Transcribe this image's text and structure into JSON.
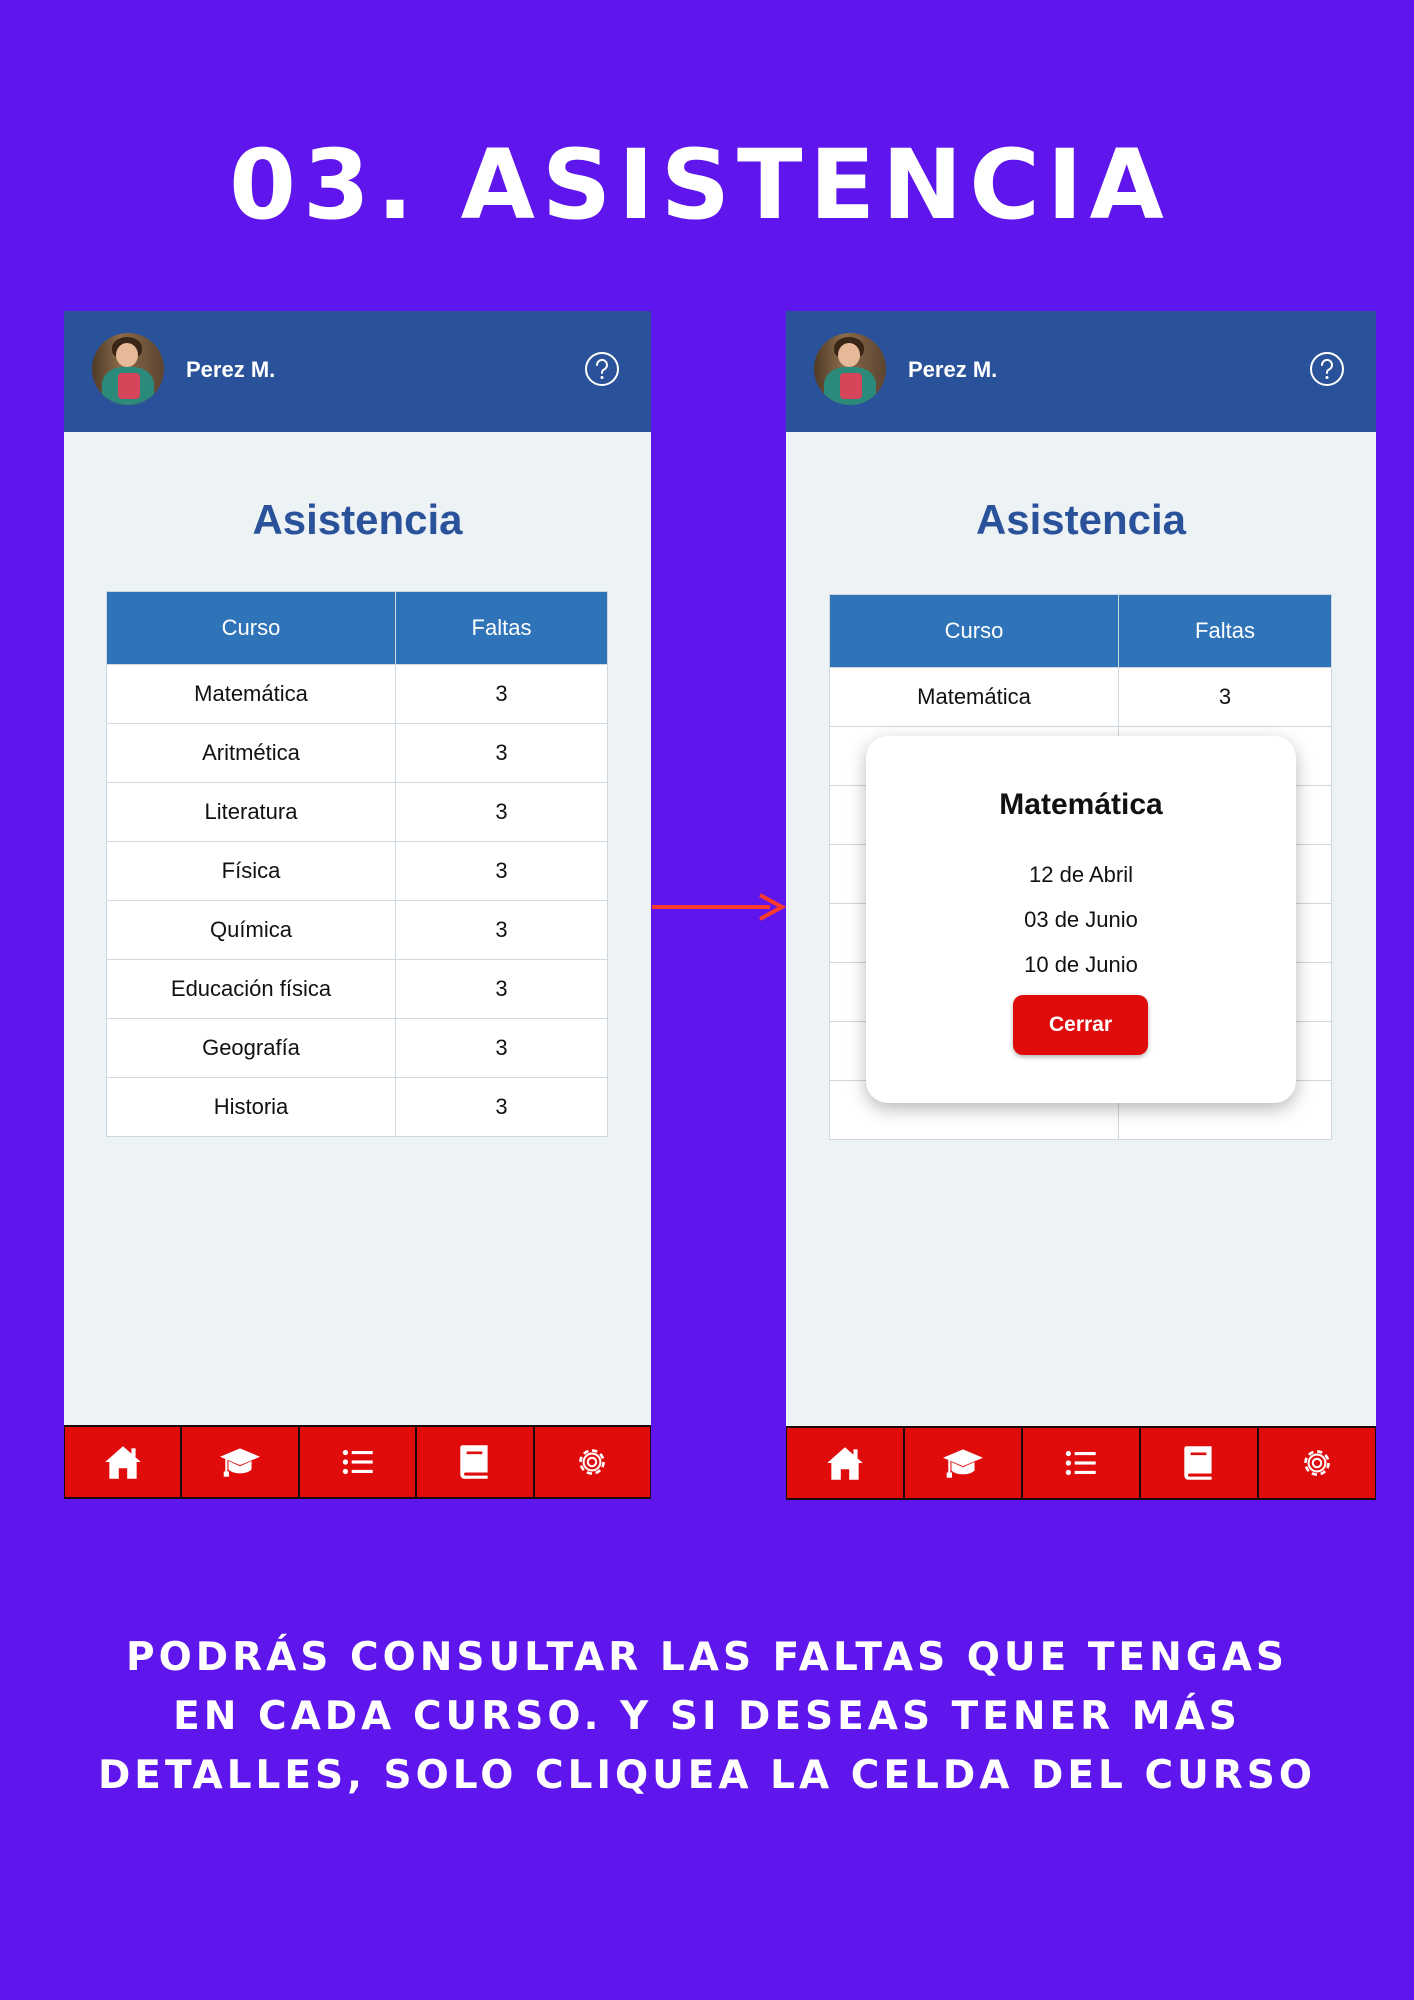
{
  "heading": "03. ASISTENCIA",
  "colors": {
    "background": "#5f16ec",
    "header": "#2a529a",
    "table_header": "#2f74b9",
    "nav": "#e00b0b",
    "screen_bg": "#edf2f5"
  },
  "left_screen": {
    "user_name": "Perez M.",
    "title": "Asistencia",
    "columns": [
      "Curso",
      "Faltas"
    ],
    "rows": [
      {
        "course": "Matemática",
        "absences": "3"
      },
      {
        "course": "Aritmética",
        "absences": "3"
      },
      {
        "course": "Literatura",
        "absences": "3"
      },
      {
        "course": "Física",
        "absences": "3"
      },
      {
        "course": "Química",
        "absences": "3"
      },
      {
        "course": "Educación física",
        "absences": "3"
      },
      {
        "course": "Geografía",
        "absences": "3"
      },
      {
        "course": "Historia",
        "absences": "3"
      }
    ]
  },
  "right_screen": {
    "user_name": "Perez M.",
    "title": "Asistencia",
    "columns": [
      "Curso",
      "Faltas"
    ],
    "rows": [
      {
        "course": "Matemática",
        "absences": "3"
      },
      {
        "course": "",
        "absences": ""
      },
      {
        "course": "",
        "absences": ""
      },
      {
        "course": "",
        "absences": ""
      },
      {
        "course": "",
        "absences": ""
      },
      {
        "course": "",
        "absences": ""
      },
      {
        "course": "",
        "absences": ""
      },
      {
        "course": "",
        "absences": ""
      }
    ],
    "modal": {
      "title": "Matemática",
      "dates": [
        "12 de Abril",
        "03 de Junio",
        "10 de Junio"
      ],
      "close_label": "Cerrar"
    }
  },
  "nav_icons": [
    "home-icon",
    "graduation-cap-icon",
    "list-icon",
    "book-icon",
    "gear-icon"
  ],
  "caption": [
    "PODRÁS CONSULTAR LAS FALTAS QUE TENGAS",
    "EN CADA CURSO. Y SI DESEAS TENER MÁS",
    "DETALLES, SOLO CLIQUEA LA CELDA DEL CURSO"
  ]
}
